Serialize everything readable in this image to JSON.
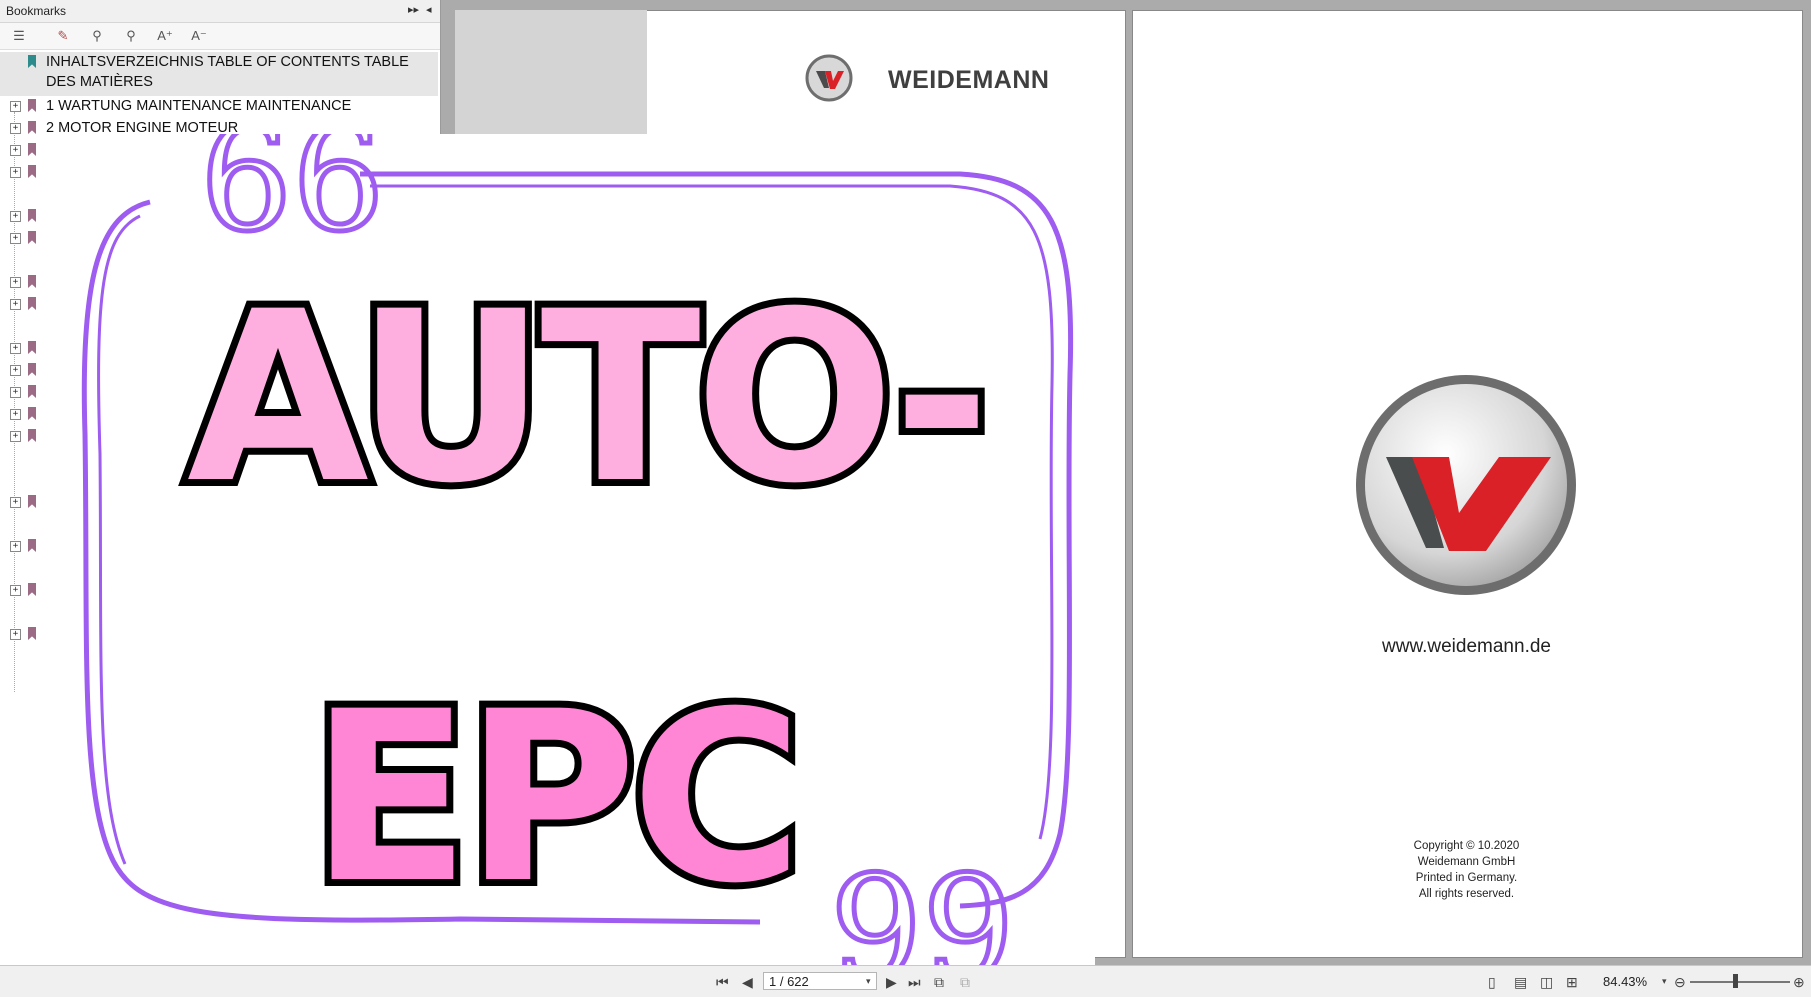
{
  "sidebar": {
    "title": "Bookmarks",
    "toolbar_icons": [
      "bookmark-options-icon",
      "new-bookmark-icon",
      "bookmark-properties-icon",
      "find-bookmark-icon",
      "increase-text-icon",
      "decrease-text-icon"
    ],
    "items": [
      {
        "label": "INHALTSVERZEICHNIS  TABLE OF CONTENTS  TABLE",
        "label2": "DES MATIÈRES"
      },
      {
        "label": "1 WARTUNG  MAINTENANCE  MAINTENANCE"
      },
      {
        "label": "2 MOTOR  ENGINE  MOTEUR"
      }
    ]
  },
  "document": {
    "brand": "WEIDEMANN",
    "url": "www.weidemann.de",
    "copyright": [
      "Copyright © 10.2020",
      "Weidemann GmbH",
      "Printed in Germany.",
      "All rights reserved."
    ]
  },
  "overlay": {
    "line1": "AUTO-",
    "line2": "EPC",
    "quote_open": "66",
    "quote_close": "99"
  },
  "status": {
    "page_field": "1 / 622",
    "zoom": "84.43%"
  },
  "colors": {
    "accent_pink": "#ffaee0",
    "accent_pink2": "#ff86d4",
    "frame_purple": "#9e5cf0",
    "logo_red": "#d92127"
  }
}
